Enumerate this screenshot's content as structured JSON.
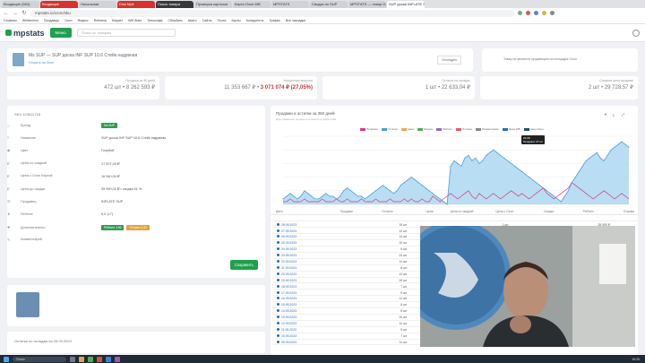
{
  "browser": {
    "tabs": [
      {
        "label": "Входящие (563)",
        "style": "normal"
      },
      {
        "label": "Входящие",
        "style": "red"
      },
      {
        "label": "Начальная",
        "style": "normal"
      },
      {
        "label": "Disk Mpit",
        "style": "red"
      },
      {
        "label": "Поиск товара",
        "style": "dark"
      },
      {
        "label": "Проверка карточки",
        "style": "normal"
      },
      {
        "label": "Карта Озон WB",
        "style": "normal"
      },
      {
        "label": "MPSTATS",
        "style": "normal"
      },
      {
        "label": "Сводка по SUP",
        "style": "normal"
      },
      {
        "label": "MPSTATS — товар Озон",
        "style": "normal"
      },
      {
        "label": "SUP доска INFLATE SUP",
        "style": "active"
      }
    ],
    "url": "mpstats.io/ozon/sku",
    "bookmarks": [
      "Сервисы",
      "Wildberries",
      "Продавцы",
      "Ozon",
      "Яндекс",
      "Reklama",
      "Маркет",
      "WB Stats",
      "Тинькофф",
      "Сбербанк",
      "Авито",
      "Сайты",
      "Почта",
      "Карты",
      "Конкуренты",
      "Трафик",
      "Все закладки"
    ]
  },
  "header": {
    "logo": "mpstats",
    "menu_button": "Меню",
    "search_placeholder": "Поиск по товарам"
  },
  "product": {
    "title": "Ms SUP — SUP доска INF SUP 10.6 Стейк надувная",
    "subtitle": "Открыть на Ozon",
    "button": "Отследить",
    "notice": "Товар не является продающим на площадке Ozon"
  },
  "stats": [
    {
      "label": "Продажи за 30 дней",
      "value": "472 шт • 8 262 593 ₽",
      "highlight": ""
    },
    {
      "label": "Упущенная выручка",
      "value": "11 353 667 ₽ •",
      "highlight": "3 071 074 ₽ (27,05%)"
    },
    {
      "label": "Остаток на складах",
      "value": "1 шт • 22 633,04 ₽",
      "highlight": ""
    },
    {
      "label": "Средняя цена продажи",
      "value": "2 шт • 29 728,57 ₽",
      "highlight": ""
    }
  ],
  "info_panel": {
    "title": "SKU 423611716",
    "rows": [
      {
        "icon": "⌂",
        "key": "Бренд",
        "value": "",
        "badge": "Ms SUP",
        "badge_color": "#2e9d4f"
      },
      {
        "icon": "≡",
        "key": "Название",
        "value": "SUP доска INF SUP 10.6 Стейк надувная",
        "badge": "",
        "badge_color": ""
      },
      {
        "icon": "◆",
        "key": "Цвет",
        "value": "Голубой",
        "badge": "",
        "badge_color": ""
      },
      {
        "icon": "₽",
        "key": "Цена со скидкой",
        "value": "17 507,00 ₽",
        "badge": "",
        "badge_color": ""
      },
      {
        "icon": "₽",
        "key": "Цена с Ozon Картой",
        "value": "16 940,00 ₽",
        "badge": "",
        "badge_color": ""
      },
      {
        "icon": "₽",
        "key": "Цена до скидки",
        "value": "35 990,00 ₽ • скидка 51 %",
        "badge": "",
        "badge_color": ""
      },
      {
        "icon": "☰",
        "key": "Продавец",
        "value": "INFLATE SUP",
        "badge": "",
        "badge_color": ""
      },
      {
        "icon": "★",
        "key": "Рейтинг",
        "value": "5,0 (17)",
        "badge": "",
        "badge_color": ""
      },
      {
        "icon": "✚",
        "key": "Дополнительно",
        "value": "",
        "badge": "Рейтинг 4,86",
        "badge_color": "#2e9d4f",
        "badge2": "Отзывы 4,42",
        "badge2_color": "#e6a23c"
      },
      {
        "icon": "✎",
        "key": "Комментарий",
        "value": "",
        "badge": "",
        "badge_color": ""
      }
    ],
    "save_button": "Сохранить"
  },
  "footer_note": "Остатки по складам на 28.09.2023",
  "chart": {
    "title": "Продажи и остатки за 360 дней",
    "subtitle": "Для сравнения продаж и остатков по двум осям",
    "legend": [
      "Продажи",
      "Остатки",
      "Цена",
      "Скидка",
      "Рейтинг",
      "Отзывы",
      "Комментарии",
      "Цена WB",
      "Цена Озон"
    ],
    "tooltip": {
      "date": "26.08",
      "label": "Продажи: 27 шт"
    }
  },
  "chart_data": {
    "type": "area",
    "series": [
      {
        "name": "Остатки",
        "values": [
          2,
          3,
          4,
          3,
          2,
          3,
          5,
          4,
          3,
          2,
          2,
          3,
          4,
          3,
          3,
          2,
          3,
          5,
          6,
          5,
          4,
          3,
          3,
          2,
          3,
          4,
          5,
          6,
          7,
          6,
          5,
          4,
          5,
          7,
          8,
          9,
          10,
          9,
          8,
          7,
          6,
          5,
          4,
          3,
          2,
          1,
          0,
          14,
          16,
          15,
          14,
          17,
          18,
          16,
          17,
          15,
          16,
          18,
          19,
          20,
          19,
          18,
          17,
          16,
          15,
          14,
          13,
          12,
          11,
          10,
          9,
          8,
          7,
          6,
          5,
          4,
          3,
          2,
          1,
          3,
          5,
          8,
          10,
          12,
          14,
          16,
          17,
          18,
          19,
          17,
          16,
          18,
          20,
          21,
          22,
          23,
          22,
          21
        ]
      },
      {
        "name": "Продажи",
        "values": [
          1,
          1,
          2,
          1,
          1,
          1,
          2,
          1,
          1,
          1,
          1,
          2,
          1,
          1,
          1,
          2,
          1,
          1,
          2,
          1,
          1,
          1,
          2,
          1,
          1,
          1,
          2,
          1,
          1,
          1,
          2,
          1,
          1,
          1,
          2,
          1,
          2,
          1,
          1,
          2,
          1,
          1,
          3,
          2,
          1,
          2,
          3,
          4,
          3,
          2,
          3,
          4,
          5,
          3,
          2,
          4,
          3,
          2,
          3,
          4,
          3,
          2,
          3,
          4,
          5,
          4,
          3,
          4,
          3,
          2,
          3,
          4,
          5,
          6,
          4,
          3,
          2,
          3,
          4,
          5,
          6,
          8,
          7,
          6,
          5,
          4,
          3,
          2,
          3,
          4,
          5,
          4,
          3,
          2,
          3,
          4,
          3,
          2
        ]
      }
    ],
    "ylim": [
      0,
      25
    ],
    "legend_position": "top"
  },
  "table": {
    "columns": [
      "Дата",
      "Продажи",
      "Остаток",
      "Цена",
      "Цена со скидкой",
      "Цена с Ozon",
      "Скидка",
      "Рейтинг",
      "Отзывы"
    ],
    "rows": [
      {
        "date": "28.09.2023",
        "sales": "15 шт",
        "stock": "1 шт",
        "price": "35 990 ₽"
      },
      {
        "date": "27.09.2023",
        "sales": "12 шт",
        "stock": "39 шт",
        "price": "35 990 ₽"
      },
      {
        "date": "26.09.2023",
        "sales": "14 шт",
        "stock": "51 шт",
        "price": "35 990 ₽"
      },
      {
        "date": "25.09.2023",
        "sales": "10 шт",
        "stock": "64 шт",
        "price": "35 990 ₽"
      },
      {
        "date": "24.09.2023",
        "sales": "9 шт",
        "stock": "74 шт",
        "price": "35 990 ₽"
      },
      {
        "date": "23.09.2023",
        "sales": "13 шт",
        "stock": "83 шт",
        "price": "35 990 ₽"
      },
      {
        "date": "22.09.2023",
        "sales": "11 шт",
        "stock": "96 шт",
        "price": "35 990 ₽"
      },
      {
        "date": "21.09.2023",
        "sales": "8 шт",
        "stock": "105 шт",
        "price": "35 990 ₽"
      },
      {
        "date": "20.09.2023",
        "sales": "12 шт",
        "stock": "113 шт",
        "price": "35 990 ₽"
      },
      {
        "date": "19.09.2023",
        "sales": "10 шт",
        "stock": "125 шт",
        "price": "35 990 ₽"
      },
      {
        "date": "18.09.2023",
        "sales": "7 шт",
        "stock": "135 шт",
        "price": "35 990 ₽"
      },
      {
        "date": "17.09.2023",
        "sales": "9 шт",
        "stock": "142 шт",
        "price": "35 990 ₽"
      },
      {
        "date": "16.09.2023",
        "sales": "11 шт",
        "stock": "151 шт",
        "price": "35 990 ₽"
      },
      {
        "date": "15.09.2023",
        "sales": "6 шт",
        "stock": "162 шт",
        "price": "35 990 ₽"
      },
      {
        "date": "14.09.2023",
        "sales": "8 шт",
        "stock": "168 шт",
        "price": "35 990 ₽"
      },
      {
        "date": "13.09.2023",
        "sales": "10 шт",
        "stock": "176 шт",
        "price": "35 990 ₽"
      },
      {
        "date": "12.09.2023",
        "sales": "12 шт",
        "stock": "186 шт",
        "price": "35 990 ₽"
      },
      {
        "date": "11.09.2023",
        "sales": "9 шт",
        "stock": "198 шт",
        "price": "35 990 ₽"
      },
      {
        "date": "10.09.2023",
        "sales": "7 шт",
        "stock": "207 шт",
        "price": "35 990 ₽"
      },
      {
        "date": "09.09.2023",
        "sales": "11 шт",
        "stock": "214 шт",
        "price": "35 990 ₽"
      }
    ]
  },
  "taskbar": {
    "search": "Поиск",
    "clock": "16:25"
  },
  "colors": {
    "accent": "#1fa04d",
    "chart_fill": "#a8d5ef",
    "chart_line": "#4a9fd8",
    "sales": "#d63a8c"
  }
}
